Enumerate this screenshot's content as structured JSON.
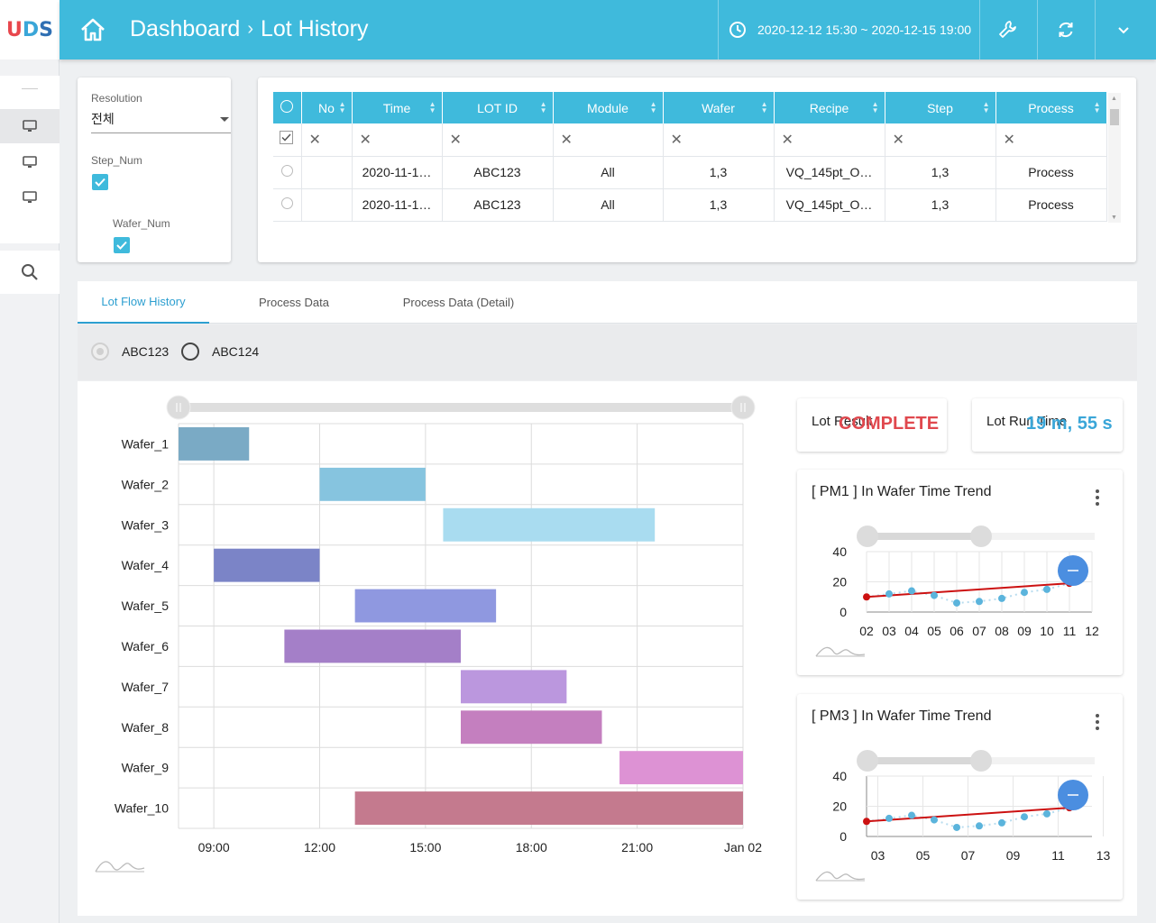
{
  "app": {
    "logo": "UDS"
  },
  "header": {
    "breadcrumb_root": "Dashboard",
    "breadcrumb_current": "Lot History",
    "date_range": "2020-12-12 15:30 ~ 2020-12-15 19:00"
  },
  "filters": {
    "resolution_label": "Resolution",
    "resolution_value": "전체",
    "step_num_label": "Step_Num",
    "step_num_checked": true,
    "wafer_num_label": "Wafer_Num",
    "wafer_num_checked": true
  },
  "grid": {
    "columns": [
      "No",
      "Time",
      "LOT ID",
      "Module",
      "Wafer",
      "Recipe",
      "Step",
      "Process"
    ],
    "rows": [
      {
        "no": "",
        "time": "2020-11-1…",
        "lot_id": "ABC123",
        "module": "All",
        "wafer": "1,3",
        "recipe": "VQ_145pt_O…",
        "step": "1,3",
        "process": "Process"
      },
      {
        "no": "",
        "time": "2020-11-1…",
        "lot_id": "ABC123",
        "module": "All",
        "wafer": "1,3",
        "recipe": "VQ_145pt_O…",
        "step": "1,3",
        "process": "Process"
      }
    ]
  },
  "tabs": [
    "Lot Flow History",
    "Process Data",
    "Process Data (Detail)"
  ],
  "active_tab": "Lot Flow History",
  "lots": {
    "options": [
      "ABC123",
      "ABC124"
    ],
    "selected": "ABC123"
  },
  "chart_data": [
    {
      "type": "bar",
      "subtype": "gantt",
      "categories": [
        "Wafer_1",
        "Wafer_2",
        "Wafer_3",
        "Wafer_4",
        "Wafer_5",
        "Wafer_6",
        "Wafer_7",
        "Wafer_8",
        "Wafer_9",
        "Wafer_10"
      ],
      "x_tick_labels": [
        "09:00",
        "12:00",
        "15:00",
        "18:00",
        "21:00",
        "Jan 02"
      ],
      "xlim_hours": [
        8.0,
        24.0
      ],
      "bars": [
        {
          "wafer": "Wafer_1",
          "start": 8.0,
          "end": 10.0,
          "color": "#7aaac5"
        },
        {
          "wafer": "Wafer_2",
          "start": 12.0,
          "end": 15.0,
          "color": "#86c4df"
        },
        {
          "wafer": "Wafer_3",
          "start": 15.5,
          "end": 21.5,
          "color": "#a9dcf0"
        },
        {
          "wafer": "Wafer_4",
          "start": 9.0,
          "end": 12.0,
          "color": "#7b84c7"
        },
        {
          "wafer": "Wafer_5",
          "start": 13.0,
          "end": 17.0,
          "color": "#8f98e0"
        },
        {
          "wafer": "Wafer_6",
          "start": 11.0,
          "end": 16.0,
          "color": "#a47fc8"
        },
        {
          "wafer": "Wafer_7",
          "start": 16.0,
          "end": 19.0,
          "color": "#bb97de"
        },
        {
          "wafer": "Wafer_8",
          "start": 16.0,
          "end": 20.0,
          "color": "#c47fbf"
        },
        {
          "wafer": "Wafer_9",
          "start": 20.5,
          "end": 24.0,
          "color": "#dd92d4"
        },
        {
          "wafer": "Wafer_10",
          "start": 13.0,
          "end": 24.0,
          "color": "#c47a8e"
        }
      ]
    },
    {
      "type": "scatter",
      "title": "[ PM1 ] In Wafer Time Trend",
      "x_tick_labels": [
        "02",
        "03",
        "04",
        "05",
        "06",
        "07",
        "08",
        "09",
        "10",
        "11",
        "12"
      ],
      "x": [
        2,
        3,
        4,
        5,
        6,
        7,
        8,
        9,
        10,
        11
      ],
      "y": [
        10,
        12,
        14,
        11,
        6,
        7,
        9,
        13,
        15,
        19
      ],
      "ylim": [
        0,
        40
      ],
      "y_ticks": [
        0,
        20,
        40
      ],
      "trend_line": {
        "x": [
          2,
          11
        ],
        "y": [
          10,
          19
        ],
        "color": "#cc1111"
      }
    },
    {
      "type": "scatter",
      "title": "[ PM3 ] In Wafer Time Trend",
      "x_tick_labels": [
        "03",
        "05",
        "07",
        "09",
        "11",
        "13"
      ],
      "x": [
        2,
        3,
        4,
        5,
        6,
        7,
        8,
        9,
        10,
        11
      ],
      "y": [
        10,
        12,
        14,
        11,
        6,
        7,
        9,
        13,
        15,
        19
      ],
      "ylim": [
        0,
        40
      ],
      "y_ticks": [
        0,
        20,
        40
      ],
      "trend_line": {
        "x": [
          2,
          11
        ],
        "y": [
          10,
          19
        ],
        "color": "#cc1111"
      }
    }
  ],
  "kpis": {
    "lot_result_label": "Lot Result",
    "lot_result_value": "COMPLETE",
    "lot_result_color": "#e0484e",
    "run_time_label": "Lot Run Time",
    "run_time_value": "19 m, 55 s",
    "run_time_color": "#3aa6d8"
  },
  "colors": {
    "accent": "#3fbadc",
    "tab_active": "#2d9fd0"
  }
}
